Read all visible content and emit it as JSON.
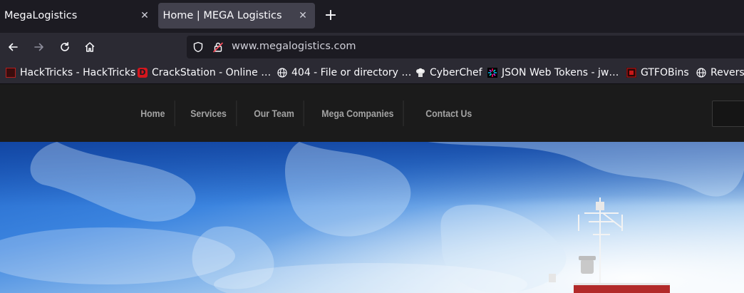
{
  "browser": {
    "tabs": [
      {
        "title": "MegaLogistics",
        "active": false
      },
      {
        "title": "Home | MEGA Logistics",
        "active": true
      }
    ],
    "url": "www.megalogistics.com",
    "bookmarks": [
      {
        "label": "HackTricks - HackTricks",
        "icon": "hacktricks-icon"
      },
      {
        "label": "CrackStation - Online …",
        "icon": "crackstation-icon"
      },
      {
        "label": "404 - File or directory …",
        "icon": "globe-icon"
      },
      {
        "label": "CyberChef",
        "icon": "cyberchef-icon"
      },
      {
        "label": "JSON Web Tokens - jw…",
        "icon": "jwt-icon"
      },
      {
        "label": "GTFOBins",
        "icon": "gtfobins-icon"
      },
      {
        "label": "Revers",
        "icon": "globe-icon"
      }
    ]
  },
  "site": {
    "nav": [
      "Home",
      "Services",
      "Our Team",
      "Mega Companies",
      "Contact Us"
    ]
  },
  "colors": {
    "tabstrip": "#1c1b22",
    "toolbar": "#2b2a33",
    "site_header": "#1b1b1b",
    "nav_text": "#a3a3a3",
    "sky": "#2a6fd6"
  }
}
